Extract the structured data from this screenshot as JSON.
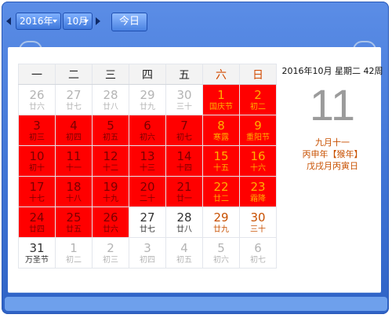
{
  "toolbar": {
    "year_label": "2016年",
    "month_label": "10月",
    "today_label": "今日"
  },
  "weekdays": [
    "一",
    "二",
    "三",
    "四",
    "五",
    "六",
    "日"
  ],
  "weeks": [
    [
      {
        "day": "26",
        "sub": "廿六",
        "style": "other"
      },
      {
        "day": "27",
        "sub": "廿七",
        "style": "other"
      },
      {
        "day": "28",
        "sub": "廿八",
        "style": "other"
      },
      {
        "day": "29",
        "sub": "廿九",
        "style": "other"
      },
      {
        "day": "30",
        "sub": "三十",
        "style": "other"
      },
      {
        "day": "1",
        "sub": "国庆节",
        "style": "red-wk holi"
      },
      {
        "day": "2",
        "sub": "初二",
        "style": "red-wk"
      }
    ],
    [
      {
        "day": "3",
        "sub": "初三",
        "style": "red"
      },
      {
        "day": "4",
        "sub": "初四",
        "style": "red"
      },
      {
        "day": "5",
        "sub": "初五",
        "style": "red"
      },
      {
        "day": "6",
        "sub": "初六",
        "style": "red"
      },
      {
        "day": "7",
        "sub": "初七",
        "style": "red"
      },
      {
        "day": "8",
        "sub": "寒露",
        "style": "red-wk"
      },
      {
        "day": "9",
        "sub": "重阳节",
        "style": "red-wk"
      }
    ],
    [
      {
        "day": "10",
        "sub": "初十",
        "style": "red"
      },
      {
        "day": "11",
        "sub": "十一",
        "style": "red"
      },
      {
        "day": "12",
        "sub": "十二",
        "style": "red"
      },
      {
        "day": "13",
        "sub": "十三",
        "style": "red"
      },
      {
        "day": "14",
        "sub": "十四",
        "style": "red"
      },
      {
        "day": "15",
        "sub": "十五",
        "style": "red-wk"
      },
      {
        "day": "16",
        "sub": "十六",
        "style": "red-wk"
      }
    ],
    [
      {
        "day": "17",
        "sub": "十七",
        "style": "red"
      },
      {
        "day": "18",
        "sub": "十八",
        "style": "red"
      },
      {
        "day": "19",
        "sub": "十九",
        "style": "red"
      },
      {
        "day": "20",
        "sub": "二十",
        "style": "red"
      },
      {
        "day": "21",
        "sub": "廿一",
        "style": "red"
      },
      {
        "day": "22",
        "sub": "廿二",
        "style": "red-wk"
      },
      {
        "day": "23",
        "sub": "霜降",
        "style": "red-wk"
      }
    ],
    [
      {
        "day": "24",
        "sub": "廿四",
        "style": "red"
      },
      {
        "day": "25",
        "sub": "廿五",
        "style": "red"
      },
      {
        "day": "26",
        "sub": "廿六",
        "style": "red"
      },
      {
        "day": "27",
        "sub": "廿七",
        "style": "cur"
      },
      {
        "day": "28",
        "sub": "廿八",
        "style": "cur"
      },
      {
        "day": "29",
        "sub": "廿九",
        "style": "cur-wk"
      },
      {
        "day": "30",
        "sub": "三十",
        "style": "cur-wk"
      }
    ],
    [
      {
        "day": "31",
        "sub": "万圣节",
        "style": "cur"
      },
      {
        "day": "1",
        "sub": "初二",
        "style": "other"
      },
      {
        "day": "2",
        "sub": "初三",
        "style": "other"
      },
      {
        "day": "3",
        "sub": "初四",
        "style": "other"
      },
      {
        "day": "4",
        "sub": "初五",
        "style": "other"
      },
      {
        "day": "5",
        "sub": "初六",
        "style": "other"
      },
      {
        "day": "6",
        "sub": "初七",
        "style": "other"
      }
    ]
  ],
  "info": {
    "header": "2016年10月  星期二  42周",
    "big_day": "11",
    "lunar_date": "九月十一",
    "year_ganzhi": "丙申年【猴年】",
    "month_day_ganzhi": "戊戌月丙寅日"
  },
  "colors": {
    "marked_day_bg": "#ff0000",
    "weekend_text": "#c85000",
    "frame_blue": "#3d72d4"
  }
}
